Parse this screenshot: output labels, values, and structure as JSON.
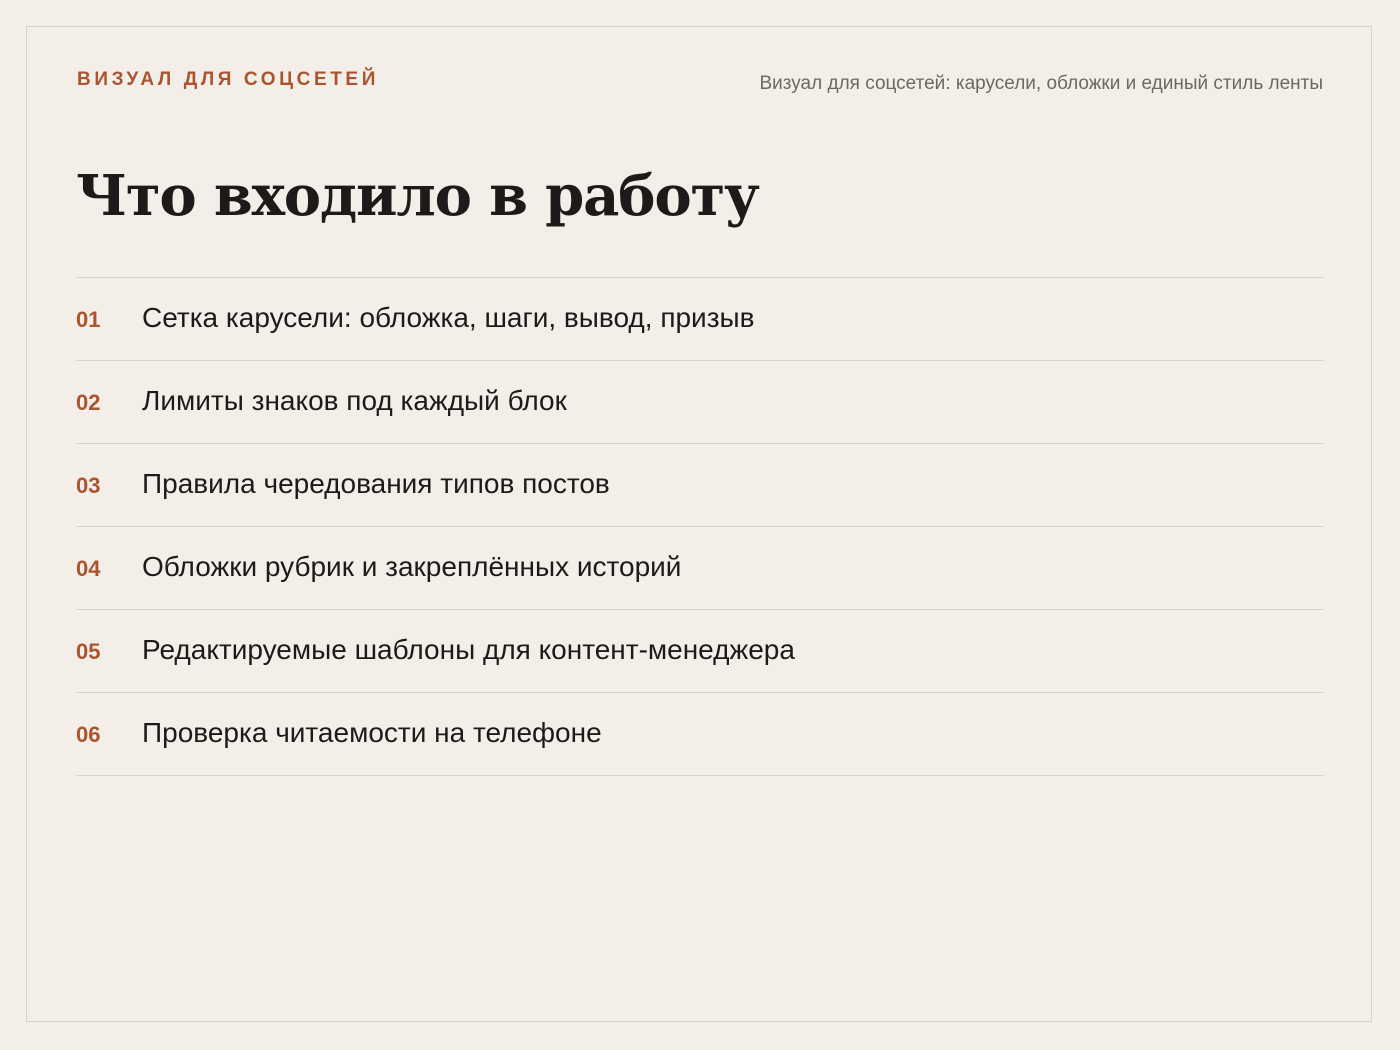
{
  "header": {
    "eyebrow": "ВИЗУАЛ ДЛЯ СОЦСЕТЕЙ",
    "note": "Визуал для соцсетей: карусели, обложки и единый стиль ленты"
  },
  "title": "Что входило в работу",
  "items": [
    {
      "num": "01",
      "text": "Сетка карусели: обложка, шаги, вывод, призыв"
    },
    {
      "num": "02",
      "text": "Лимиты знаков под каждый блок"
    },
    {
      "num": "03",
      "text": "Правила чередования типов постов"
    },
    {
      "num": "04",
      "text": "Обложки рубрик и закреплённых историй"
    },
    {
      "num": "05",
      "text": "Редактируемые шаблоны для контент-менеджера"
    },
    {
      "num": "06",
      "text": "Проверка читаемости на телефоне"
    }
  ],
  "colors": {
    "background": "#f3eee8",
    "accent": "#a9552f",
    "text": "#1d1b19",
    "muted": "#6d6862",
    "divider": "#d8d2cb"
  }
}
